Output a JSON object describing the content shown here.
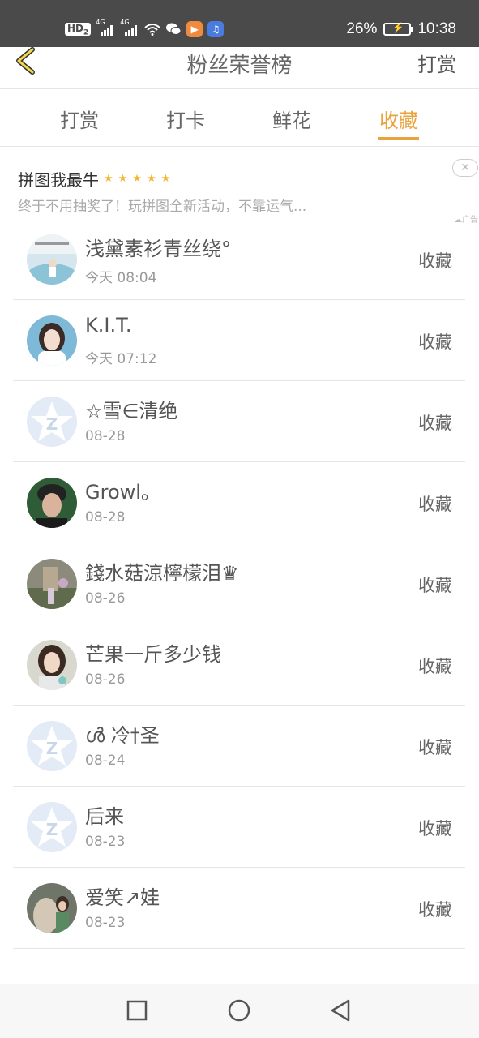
{
  "status_bar": {
    "hd_label": "HD",
    "hd_sub": "2",
    "signal1_label": "4G",
    "signal2_label": "4G",
    "battery": "26%",
    "time": "10:38"
  },
  "header": {
    "title": "粉丝荣誉榜",
    "action": "打赏"
  },
  "tabs": [
    {
      "label": "打赏"
    },
    {
      "label": "打卡"
    },
    {
      "label": "鲜花"
    },
    {
      "label": "收藏"
    }
  ],
  "active_tab": "收藏",
  "ad": {
    "title": "拼图我最牛",
    "stars": "★★★★★",
    "rating": 5,
    "description": "终于不用抽奖了！玩拼图全新活动，不靠运气...",
    "badge": "广告"
  },
  "list": [
    {
      "name": "浅黛素衫青丝绕°",
      "time": "今天 08:04",
      "tag": "收藏",
      "avatar": "photo-sky"
    },
    {
      "name": "K.I.T.",
      "time": "今天 07:12",
      "tag": "收藏",
      "avatar": "photo-girl"
    },
    {
      "name": "☆雪∈清绝",
      "time": "08-28",
      "tag": "收藏",
      "avatar": "default-qzone"
    },
    {
      "name": "Growl。",
      "time": "08-28",
      "tag": "收藏",
      "avatar": "photo-boy"
    },
    {
      "name": "錢水菇涼檸檬泪♛",
      "time": "08-26",
      "tag": "收藏",
      "avatar": "photo-garden"
    },
    {
      "name": "芒果一斤多少钱",
      "time": "08-26",
      "tag": "收藏",
      "avatar": "photo-woman"
    },
    {
      "name": "ൾ 冷†圣",
      "time": "08-24",
      "tag": "收藏",
      "avatar": "default-qzone"
    },
    {
      "name": "后来",
      "time": "08-23",
      "tag": "收藏",
      "avatar": "default-qzone"
    },
    {
      "name": "爱笑↗娃",
      "time": "08-23",
      "tag": "收藏",
      "avatar": "photo-group"
    }
  ],
  "colors": {
    "accent": "#e8a33d",
    "status_bar": "#4a4a4a",
    "divider": "#e6e6e6"
  }
}
